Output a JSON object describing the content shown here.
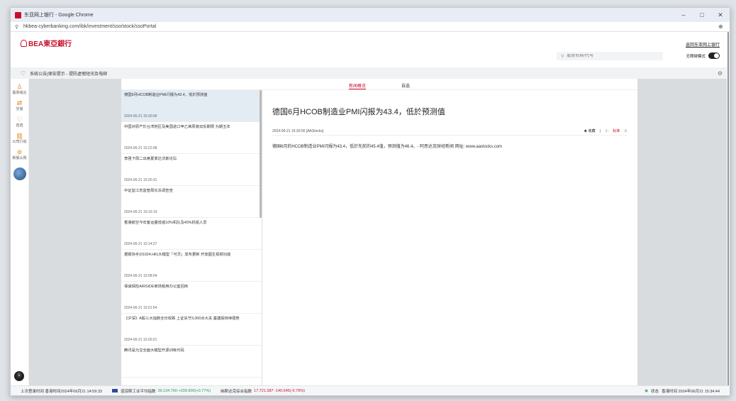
{
  "window": {
    "title": "东亚网上银行 - Google Chrome",
    "controls": [
      "–",
      "□",
      "✕"
    ]
  },
  "address": {
    "url": "hkbea-cyberbanking.com/ibk/investment/sso/stock/ssoPortal"
  },
  "header": {
    "logo_text": "BEA東亞銀行",
    "back_link": "返回东亚网上银行",
    "search_placeholder": "股票名称/代号",
    "mode_label": "无障碍模式"
  },
  "notice": {
    "text": "系统公告|保安提示 - 提防虚假短讯及电邮"
  },
  "sidebar": {
    "items": [
      {
        "icon": "♙",
        "label": "股票组合"
      },
      {
        "icon": "⇄",
        "label": "交易"
      },
      {
        "icon": "♡",
        "label": "自选"
      },
      {
        "icon": "▥",
        "label": "公司行动"
      },
      {
        "icon": "⊜",
        "label": "新股认购"
      }
    ],
    "chatbot_label": "ⓑ"
  },
  "tabs": [
    {
      "label": "新闻概览",
      "active": true
    },
    {
      "label": "自选",
      "active": false
    }
  ],
  "news": [
    {
      "title": "德国6月HCOB制造业PMI闪报为43.4，低於预测值",
      "time": "2024-06-21 15:30:00",
      "selected": true
    },
    {
      "title": "中国对原产於台湾地区及美国进口甲乙烯原装双反期限 为期五年",
      "time": "2024-06-21 15:22:08",
      "selected": false
    },
    {
      "title": "李强下周二出席夏季达沃斯论坛",
      "time": "2024-06-21 15:20:31",
      "selected": false
    },
    {
      "title": "中证监江苏监管局长冻调查查",
      "time": "2024-06-21 15:16:19",
      "selected": false
    },
    {
      "title": "香港航空今年客运量增逾10%机队及40%机组人员",
      "time": "2024-06-21 15:14:27",
      "selected": false
    },
    {
      "title": "据报快手(01024.HK)大模型「可灵」发布更新 开放图生视频功能",
      "time": "2024-06-21 15:08:04",
      "selected": false
    },
    {
      "title": "保诚保险AIRSIDE商场租用办公室回用",
      "time": "2024-06-21 15:01:54",
      "selected": false
    },
    {
      "title": "《沪深》A股三大指数全日收跌 上证失守3,000点大关 基建股持续强势",
      "time": "2024-06-21 15:00:21",
      "selected": false
    },
    {
      "title": "腾讯是元宝全面大模型开源训练代码",
      "time": "",
      "selected": false
    }
  ],
  "article": {
    "title": "德国6月HCOB制造业PMI闪报为43.4，低於预测值",
    "meta": "2024-06-21 15:30:00  [AAStocks]",
    "fav_label": "★ 收藏",
    "sizes": [
      "小",
      "标准",
      "大"
    ],
    "active_size": "标准",
    "body": "德国6月的HCOB制造业PMI闪报为43.4，低於先前的45.4值，预测值为46.4。- 阿思达克财经新闻 网址: www.aastocks.com"
  },
  "status": {
    "last_login": "上次登录时间 香港时间2024年06月21 14:59:33",
    "dow_label": "道琼斯工业平均指数",
    "dow_value": "39,134.760 +299.900(+0.77%)",
    "nasdaq_label": "纳斯达克综合指数",
    "nasdaq_value": "17,721.587 -140.645(-0.79%)",
    "state_label": "状态",
    "hk_time": "香港时间 2024年06月21 15:34:44"
  }
}
